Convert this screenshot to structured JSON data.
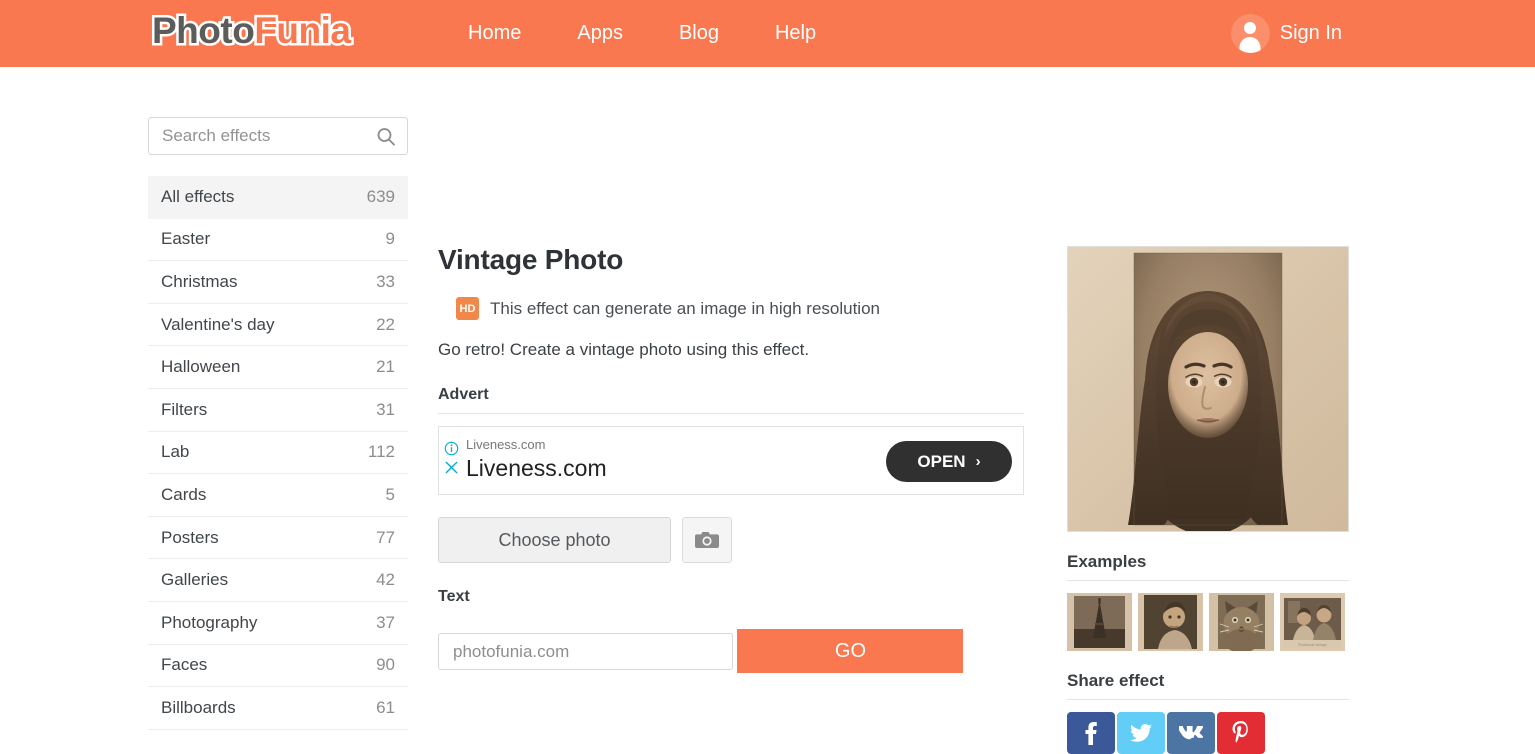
{
  "header": {
    "logo_part1": "Photo",
    "logo_part2": "Funia",
    "nav": [
      {
        "label": "Home"
      },
      {
        "label": "Apps"
      },
      {
        "label": "Blog"
      },
      {
        "label": "Help"
      }
    ],
    "signin_label": "Sign In",
    "background_color": "#f97850"
  },
  "sidebar": {
    "search_placeholder": "Search effects",
    "search_value": "",
    "categories": [
      {
        "label": "All effects",
        "count": "639",
        "active": true
      },
      {
        "label": "Easter",
        "count": "9",
        "active": false
      },
      {
        "label": "Christmas",
        "count": "33",
        "active": false
      },
      {
        "label": "Valentine's day",
        "count": "22",
        "active": false
      },
      {
        "label": "Halloween",
        "count": "21",
        "active": false
      },
      {
        "label": "Filters",
        "count": "31",
        "active": false
      },
      {
        "label": "Lab",
        "count": "112",
        "active": false
      },
      {
        "label": "Cards",
        "count": "5",
        "active": false
      },
      {
        "label": "Posters",
        "count": "77",
        "active": false
      },
      {
        "label": "Galleries",
        "count": "42",
        "active": false
      },
      {
        "label": "Photography",
        "count": "37",
        "active": false
      },
      {
        "label": "Faces",
        "count": "90",
        "active": false
      },
      {
        "label": "Billboards",
        "count": "61",
        "active": false
      }
    ]
  },
  "main": {
    "effect_title": "Vintage Photo",
    "hd_badge": "HD",
    "hd_text": "This effect can generate an image in high resolution",
    "description": "Go retro! Create a vintage photo using this effect.",
    "advert_label": "Advert",
    "advert": {
      "small_title": "Liveness.com",
      "big_title": "Liveness.com",
      "open_label": "OPEN",
      "open_chevron": "›",
      "info_icon": "info-circle-icon",
      "close_icon": "close-icon",
      "accent_color": "#00aecd",
      "button_color": "#303030"
    },
    "choose_photo_label": "Choose photo",
    "camera_icon": "camera-icon",
    "text_label": "Text",
    "text_placeholder": "photofunia.com",
    "text_value": "",
    "go_label": "GO",
    "go_color": "#f97850"
  },
  "right": {
    "preview_alt": "vintage sepia portrait of a woman",
    "examples_title": "Examples",
    "examples": [
      {
        "name": "eiffel-tower-vintage"
      },
      {
        "name": "man-portrait-vintage"
      },
      {
        "name": "cat-vintage"
      },
      {
        "name": "couple-vintage"
      }
    ],
    "share_title": "Share effect",
    "share_buttons": [
      {
        "name": "facebook",
        "color": "#3b5998"
      },
      {
        "name": "twitter",
        "color": "#62cdf6"
      },
      {
        "name": "vk",
        "color": "#4c75a3"
      },
      {
        "name": "pinterest",
        "color": "#e12d33"
      }
    ]
  }
}
